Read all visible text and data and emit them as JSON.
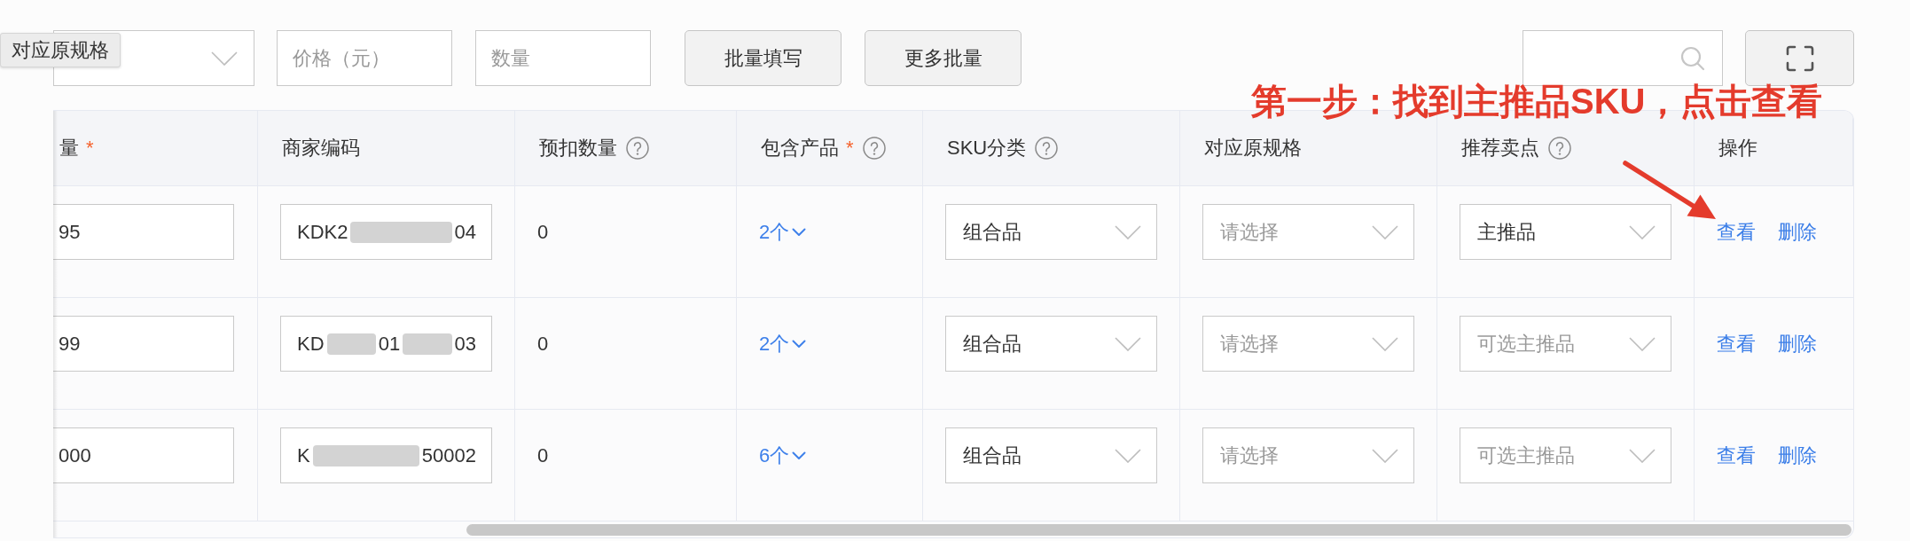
{
  "tooltip": {
    "text": "对应原规格"
  },
  "toolbar": {
    "price_field": {
      "placeholder": "价格（元）"
    },
    "quantity_field": {
      "placeholder": "数量"
    },
    "buttons": [
      "批量填写",
      "更多批量"
    ]
  },
  "annotation": {
    "text": "第一步：找到主推品SKU，点击查看"
  },
  "table": {
    "columns": [
      {
        "label": "量",
        "required_mark": "*",
        "help_icon": false
      },
      {
        "label": "商家编码",
        "help_icon": false
      },
      {
        "label": "预扣数量",
        "help_icon": true
      },
      {
        "label": "包含产品",
        "required_mark": "*",
        "help_icon": true
      },
      {
        "label": "SKU分类",
        "help_icon": true
      },
      {
        "label": "对应原规格",
        "help_icon": false
      },
      {
        "label": "推荐卖点",
        "help_icon": true
      },
      {
        "label": "操作",
        "help_icon": false
      }
    ],
    "rows": [
      {
        "column_1": "95",
        "merchant_code": [
          "KDK2",
          "04"
        ],
        "reserved_quantity": "0",
        "products": "2个",
        "sku_category": {
          "value": "组合品"
        },
        "original_spec": {
          "placeholder": "请选择"
        },
        "selling_point": {
          "value": "主推品"
        },
        "actions": [
          "查看",
          "删除"
        ]
      },
      {
        "column_1": "99",
        "merchant_code": [
          "KD",
          "01",
          "03"
        ],
        "reserved_quantity": "0",
        "products": "2个",
        "sku_category": {
          "value": "组合品"
        },
        "original_spec": {
          "placeholder": "请选择"
        },
        "selling_point": {
          "placeholder": "可选主推品"
        },
        "actions": [
          "查看",
          "删除"
        ]
      },
      {
        "column_1": "000",
        "merchant_code": [
          "K",
          "50002"
        ],
        "reserved_quantity": "0",
        "products": "6个",
        "sku_category": {
          "value": "组合品"
        },
        "original_spec": {
          "placeholder": "请选择"
        },
        "selling_point": {
          "placeholder": "可选主推品"
        },
        "actions": [
          "查看",
          "删除"
        ]
      }
    ]
  }
}
